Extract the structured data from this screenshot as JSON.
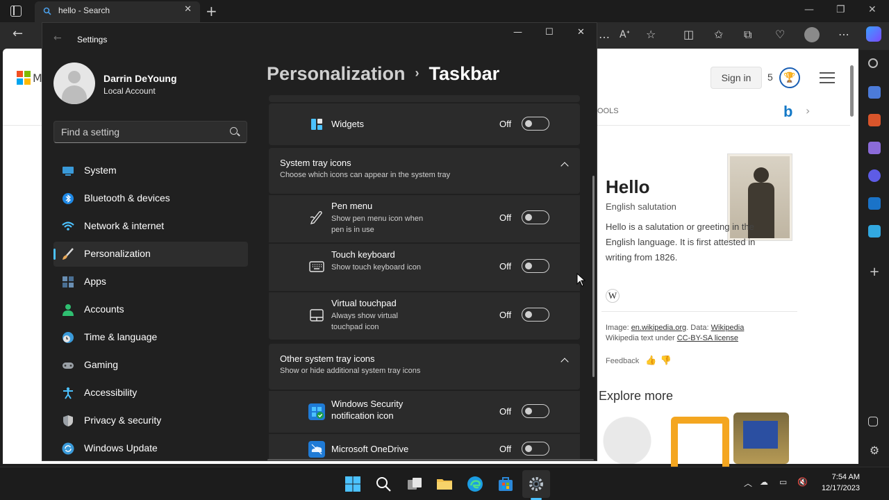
{
  "browser": {
    "tab_title": "hello - Search",
    "tab_close": "✕",
    "new_tab": "+",
    "window_minimize": "—",
    "window_restore": "❐",
    "window_close": "✕"
  },
  "bing": {
    "logo_text": "M",
    "signin_label": "Sign in",
    "rewards_count": "5",
    "tools_label": "OOLS",
    "knowledge_panel": {
      "title": "Hello",
      "subtitle": "English salutation",
      "description": "Hello is a salutation or greeting in the English language. It is first attested in writing from 1826.",
      "wiki_glyph": "W",
      "credit_image_label": "Image: ",
      "credit_image_link": "en.wikipedia.org",
      "credit_data_label": ". Data: ",
      "credit_data_link": "Wikipedia",
      "credit_text_label": "Wikipedia text under ",
      "credit_license_link": "CC-BY-SA license",
      "feedback_label": "Feedback"
    },
    "explore_title": "Explore more"
  },
  "settings": {
    "window_title": "Settings",
    "minimize": "—",
    "maximize": "☐",
    "close": "✕",
    "user": {
      "name": "Darrin DeYoung",
      "account_type": "Local Account"
    },
    "search_placeholder": "Find a setting",
    "nav": [
      {
        "label": "System",
        "icon": "system-icon",
        "color": "#3a9ad9"
      },
      {
        "label": "Bluetooth & devices",
        "icon": "bluetooth-icon",
        "color": "#1e88e5"
      },
      {
        "label": "Network & internet",
        "icon": "wifi-icon",
        "color": "#4cc2ff"
      },
      {
        "label": "Personalization",
        "icon": "brush-icon",
        "color": "#e8a85a"
      },
      {
        "label": "Apps",
        "icon": "apps-icon",
        "color": "#6a8fb3"
      },
      {
        "label": "Accounts",
        "icon": "accounts-icon",
        "color": "#2fbf71"
      },
      {
        "label": "Time & language",
        "icon": "clock-globe-icon",
        "color": "#3a9ad9"
      },
      {
        "label": "Gaming",
        "icon": "gamepad-icon",
        "color": "#9aa0a6"
      },
      {
        "label": "Accessibility",
        "icon": "accessibility-icon",
        "color": "#4cc2ff"
      },
      {
        "label": "Privacy & security",
        "icon": "shield-icon",
        "color": "#9aa0a6"
      },
      {
        "label": "Windows Update",
        "icon": "update-icon",
        "color": "#3a9ad9"
      }
    ],
    "header": {
      "parent": "Personalization",
      "separator": "›",
      "current": "Taskbar"
    },
    "widgets": {
      "title": "Widgets",
      "state": "Off"
    },
    "system_tray": {
      "title": "System tray icons",
      "subtitle": "Choose which icons can appear in the system tray",
      "items": [
        {
          "title": "Pen menu",
          "subtitle": "Show pen menu icon when pen is in use",
          "state": "Off",
          "icon": "pen-icon"
        },
        {
          "title": "Touch keyboard",
          "subtitle": "Show touch keyboard icon",
          "state": "Off",
          "icon": "keyboard-icon"
        },
        {
          "title": "Virtual touchpad",
          "subtitle": "Always show virtual touchpad icon",
          "state": "Off",
          "icon": "touchpad-icon"
        }
      ]
    },
    "other_tray": {
      "title": "Other system tray icons",
      "subtitle": "Show or hide additional system tray icons",
      "items": [
        {
          "title": "Windows Security notification icon",
          "state": "Off",
          "icon": "windows-security-icon"
        },
        {
          "title": "Microsoft OneDrive",
          "state": "Off",
          "icon": "onedrive-icon"
        }
      ]
    }
  },
  "taskbar": {
    "time": "7:54 AM",
    "date": "12/17/2023"
  },
  "colors": {
    "accent": "#4cc2ff",
    "settings_bg": "#202020",
    "card_bg": "#2b2b2b"
  }
}
